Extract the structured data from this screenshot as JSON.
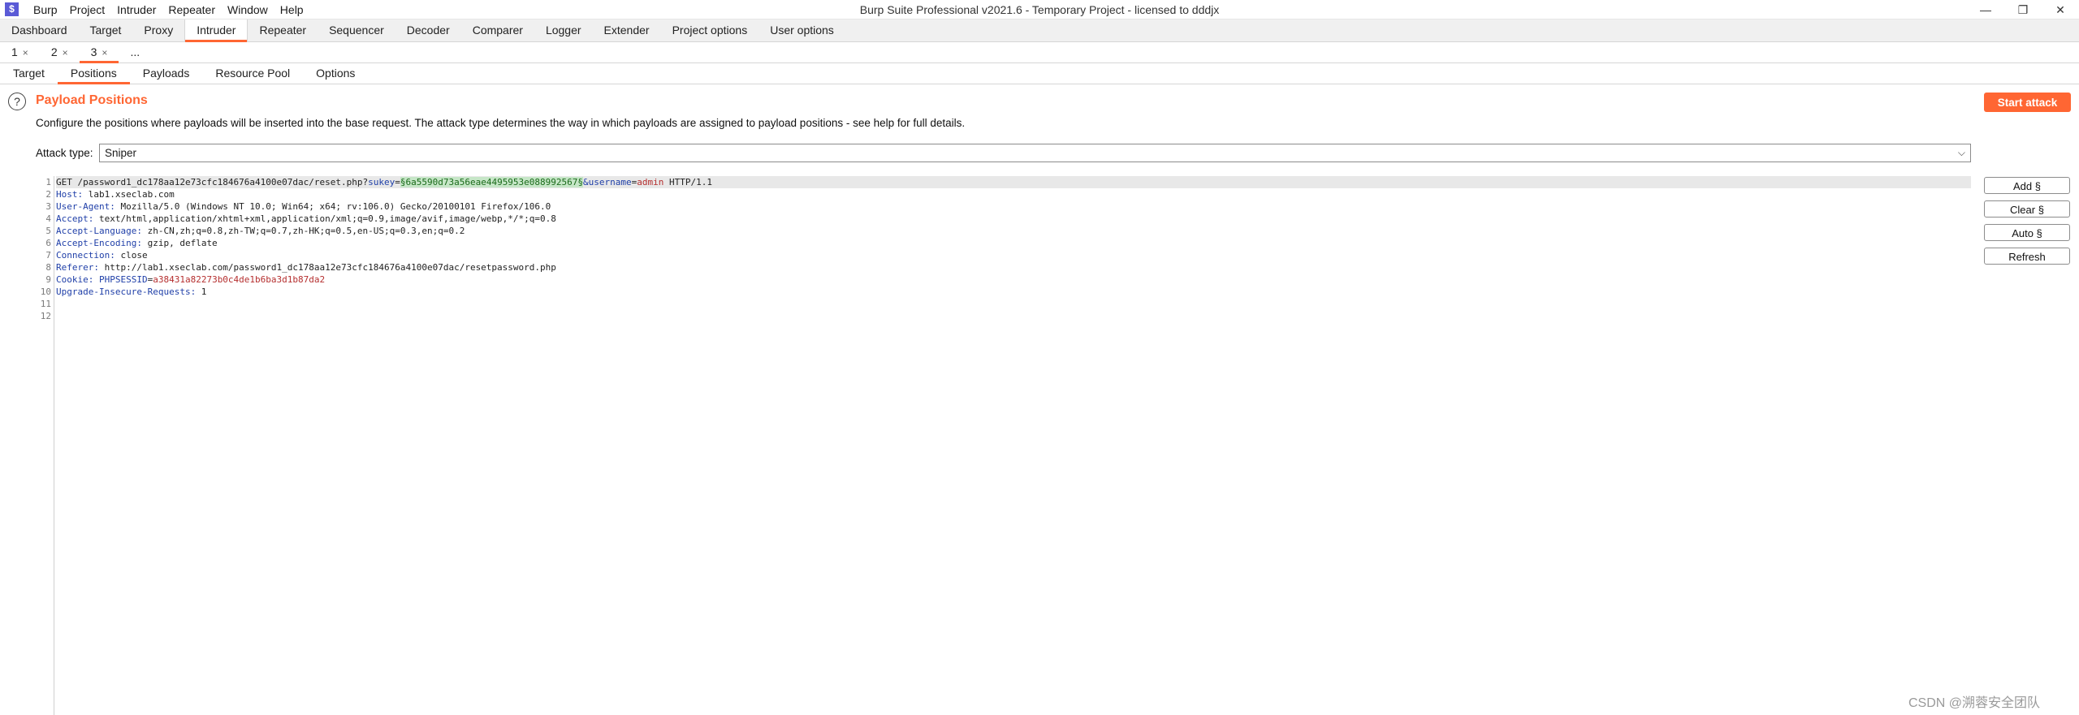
{
  "app_icon": "$",
  "menu": [
    "Burp",
    "Project",
    "Intruder",
    "Repeater",
    "Window",
    "Help"
  ],
  "window_title": "Burp Suite Professional v2021.6 - Temporary Project - licensed to dddjx",
  "window_controls": {
    "minimize": "—",
    "restore": "❐",
    "close": "✕"
  },
  "main_tabs": [
    "Dashboard",
    "Target",
    "Proxy",
    "Intruder",
    "Repeater",
    "Sequencer",
    "Decoder",
    "Comparer",
    "Logger",
    "Extender",
    "Project options",
    "User options"
  ],
  "instance_tabs": [
    {
      "label": "1",
      "close": "×"
    },
    {
      "label": "2",
      "close": "×"
    },
    {
      "label": "3",
      "close": "×"
    },
    {
      "label": "...",
      "close": ""
    }
  ],
  "sub_tabs": [
    "Target",
    "Positions",
    "Payloads",
    "Resource Pool",
    "Options"
  ],
  "panel": {
    "help": "?",
    "title": "Payload Positions",
    "description": "Configure the positions where payloads will be inserted into the base request. The attack type determines the way in which payloads are assigned to payload positions - see help for full details.",
    "start_attack": "Start attack",
    "attack_type_label": "Attack type:",
    "attack_type_value": "Sniper",
    "chevron": "⌵"
  },
  "request": {
    "line1": {
      "method": "GET /password1_dc178aa12e73cfc184676a4100e07dac/reset.php?",
      "param1_key": "sukey",
      "eq1": "=",
      "payload": "§6a5590d73a56eae4495953e088992567§",
      "amp": "&",
      "param2_key": "username",
      "eq2": "=",
      "param2_val": "admin",
      "proto": " HTTP/1.1"
    },
    "lines": [
      {
        "key": "Host:",
        "value": " lab1.xseclab.com"
      },
      {
        "key": "User-Agent:",
        "value": " Mozilla/5.0 (Windows NT 10.0; Win64; x64; rv:106.0) Gecko/20100101 Firefox/106.0"
      },
      {
        "key": "Accept:",
        "value": " text/html,application/xhtml+xml,application/xml;q=0.9,image/avif,image/webp,*/*;q=0.8"
      },
      {
        "key": "Accept-Language:",
        "value": " zh-CN,zh;q=0.8,zh-TW;q=0.7,zh-HK;q=0.5,en-US;q=0.3,en;q=0.2"
      },
      {
        "key": "Accept-Encoding:",
        "value": " gzip, deflate"
      },
      {
        "key": "Connection:",
        "value": " close"
      },
      {
        "key": "Referer:",
        "value": " http://lab1.xseclab.com/password1_dc178aa12e73cfc184676a4100e07dac/resetpassword.php"
      }
    ],
    "cookie": {
      "key": "Cookie:",
      "name": " PHPSESSID",
      "eq": "=",
      "value": "a38431a82273b0c4de1b6ba3d1b87da2"
    },
    "upgrade": {
      "key": "Upgrade-Insecure-Requests:",
      "value": " 1"
    },
    "line_numbers": [
      "1",
      "2",
      "3",
      "4",
      "5",
      "6",
      "7",
      "8",
      "9",
      "10",
      "11",
      "12"
    ]
  },
  "side_buttons": [
    "Add §",
    "Clear §",
    "Auto §",
    "Refresh"
  ],
  "watermark": "CSDN @溯蓉安全团队",
  "colors": {
    "accent": "#ff6633",
    "header_key": "#1f3fa8",
    "cookie_value": "#b52f2f",
    "payload_bg": "#c6e6c7"
  }
}
